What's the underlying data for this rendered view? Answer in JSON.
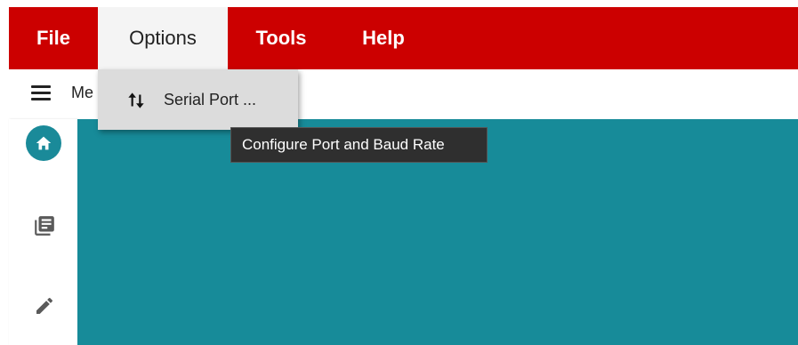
{
  "menubar": {
    "items": [
      {
        "label": "File"
      },
      {
        "label": "Options"
      },
      {
        "label": "Tools"
      },
      {
        "label": "Help"
      }
    ],
    "active": "Options",
    "color": "#cc0000"
  },
  "toolbar": {
    "menu_icon": "hamburger-icon",
    "label": "Me"
  },
  "sidebar": {
    "items": [
      {
        "icon": "home-icon",
        "active": true
      },
      {
        "icon": "library-icon"
      },
      {
        "icon": "pencil-icon"
      }
    ],
    "accent": "#1a8a99"
  },
  "dropdown": {
    "items": [
      {
        "icon": "swap-vertical-icon",
        "label": "Serial Port ..."
      }
    ]
  },
  "tooltip": {
    "text": "Configure Port and Baud Rate"
  },
  "content": {
    "background": "#178b99"
  }
}
